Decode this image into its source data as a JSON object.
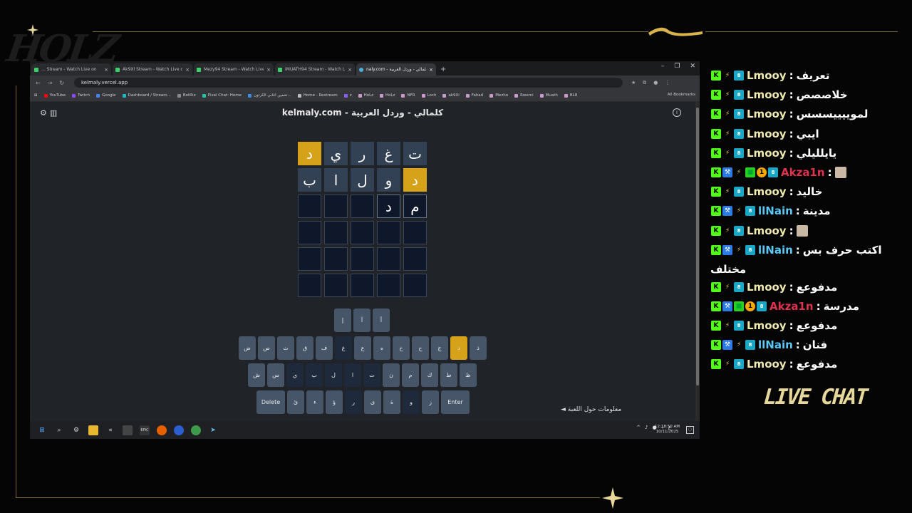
{
  "overlay": {
    "logo_text": "HOLZ",
    "live_chat_label": "LIVE CHAT"
  },
  "browser": {
    "tabs": [
      {
        "label": "... Stream - Watch Live on",
        "active": false
      },
      {
        "label": "Ak9Xl Stream - Watch Live on K",
        "active": false
      },
      {
        "label": "Mezy94 Stream - Watch Live o",
        "active": false
      },
      {
        "label": "iMUATH94 Stream - Watch Live",
        "active": false
      },
      {
        "label": "naly.com - كلمالي - وردل العربية",
        "active": true
      }
    ],
    "new_tab_label": "+",
    "url": "kelmaly.vercel.app",
    "bookmarks": [
      "YouTube",
      "Twitch",
      "Google",
      "Dashboard / Stream...",
      "BotRix",
      "Pixel Chat: Home",
      "تخمين اغاني الكرتون...",
      "Home - Restream",
      "z",
      "HoLz",
      "HoLz",
      "NFR",
      "Loch",
      "ak9Xl",
      "Fahad",
      "Mezho",
      "Rwemi",
      "Muath",
      "BL8"
    ],
    "all_bookmarks": "All Bookmarks"
  },
  "game": {
    "title": "kelmaly.com - كلمالي - وردل العربية",
    "rows": [
      [
        {
          "ch": "د",
          "s": "present"
        },
        {
          "ch": "ي",
          "s": "absent"
        },
        {
          "ch": "ر",
          "s": "absent"
        },
        {
          "ch": "غ",
          "s": "absent"
        },
        {
          "ch": "ت",
          "s": "absent"
        }
      ],
      [
        {
          "ch": "ب",
          "s": "absent"
        },
        {
          "ch": "ا",
          "s": "absent"
        },
        {
          "ch": "ل",
          "s": "absent"
        },
        {
          "ch": "و",
          "s": "absent"
        },
        {
          "ch": "د",
          "s": "present"
        }
      ],
      [
        {
          "ch": "",
          "s": "empty"
        },
        {
          "ch": "",
          "s": "empty"
        },
        {
          "ch": "",
          "s": "empty"
        },
        {
          "ch": "د",
          "s": "typed"
        },
        {
          "ch": "م",
          "s": "typed"
        }
      ],
      [
        {
          "ch": "",
          "s": "empty"
        },
        {
          "ch": "",
          "s": "empty"
        },
        {
          "ch": "",
          "s": "empty"
        },
        {
          "ch": "",
          "s": "empty"
        },
        {
          "ch": "",
          "s": "empty"
        }
      ],
      [
        {
          "ch": "",
          "s": "empty"
        },
        {
          "ch": "",
          "s": "empty"
        },
        {
          "ch": "",
          "s": "empty"
        },
        {
          "ch": "",
          "s": "empty"
        },
        {
          "ch": "",
          "s": "empty"
        }
      ],
      [
        {
          "ch": "",
          "s": "empty"
        },
        {
          "ch": "",
          "s": "empty"
        },
        {
          "ch": "",
          "s": "empty"
        },
        {
          "ch": "",
          "s": "empty"
        },
        {
          "ch": "",
          "s": "empty"
        }
      ]
    ],
    "keyboard": [
      [
        {
          "k": "إ"
        },
        {
          "k": "آ"
        },
        {
          "k": "أ"
        }
      ],
      [
        {
          "k": "ض"
        },
        {
          "k": "ص"
        },
        {
          "k": "ث"
        },
        {
          "k": "ق"
        },
        {
          "k": "ف"
        },
        {
          "k": "غ",
          "s": "absent"
        },
        {
          "k": "ع"
        },
        {
          "k": "ه"
        },
        {
          "k": "خ"
        },
        {
          "k": "ح"
        },
        {
          "k": "ج"
        },
        {
          "k": "د",
          "s": "present"
        },
        {
          "k": "ذ"
        }
      ],
      [
        {
          "k": "ش"
        },
        {
          "k": "س"
        },
        {
          "k": "ي",
          "s": "absent"
        },
        {
          "k": "ب",
          "s": "absent"
        },
        {
          "k": "ل",
          "s": "absent"
        },
        {
          "k": "ا",
          "s": "absent"
        },
        {
          "k": "ت",
          "s": "absent"
        },
        {
          "k": "ن"
        },
        {
          "k": "م"
        },
        {
          "k": "ك"
        },
        {
          "k": "ط"
        },
        {
          "k": "ظ"
        }
      ],
      [
        {
          "k": "Delete"
        },
        {
          "k": "ئ"
        },
        {
          "k": "ء"
        },
        {
          "k": "ؤ"
        },
        {
          "k": "ر",
          "s": "absent"
        },
        {
          "k": "ى"
        },
        {
          "k": "ة"
        },
        {
          "k": "و",
          "s": "absent"
        },
        {
          "k": "ز"
        },
        {
          "k": "Enter"
        }
      ]
    ],
    "footer_link": "◄ معلومات حول اللعبة"
  },
  "taskbar": {
    "clock_time": "12:18:50 AM",
    "clock_date": "10/11/2025",
    "lang": "ع"
  },
  "chat": {
    "messages": [
      {
        "user": "Lmooy",
        "text": "تعريف",
        "badges": [
          "k",
          "bolt",
          "sub"
        ],
        "color": "#f0e9b0"
      },
      {
        "user": "Lmooy",
        "text": "خلاصصص",
        "badges": [
          "k",
          "bolt",
          "sub"
        ],
        "color": "#f0e9b0"
      },
      {
        "user": "Lmooy",
        "text": "لموييييسسس",
        "badges": [
          "k",
          "bolt",
          "sub"
        ],
        "color": "#f0e9b0"
      },
      {
        "user": "Lmooy",
        "text": "ايبي",
        "badges": [
          "k",
          "bolt",
          "sub"
        ],
        "color": "#f0e9b0"
      },
      {
        "user": "Lmooy",
        "text": "يايلليلي",
        "badges": [
          "k",
          "bolt",
          "sub"
        ],
        "color": "#f0e9b0"
      },
      {
        "user": "Akza1n",
        "text": "",
        "badges": [
          "k",
          "sword",
          "bolt",
          "cube",
          "num",
          "sub"
        ],
        "color": "#e0314f",
        "emote": true
      },
      {
        "user": "Lmooy",
        "text": "خاليد",
        "badges": [
          "k",
          "bolt",
          "sub"
        ],
        "color": "#f0e9b0"
      },
      {
        "user": "llNain",
        "text": "مدينة",
        "badges": [
          "k",
          "sword",
          "bolt",
          "sub"
        ],
        "color": "#5bc8f5"
      },
      {
        "user": "Lmooy",
        "text": "",
        "badges": [
          "k",
          "bolt",
          "sub"
        ],
        "color": "#f0e9b0",
        "emote": true
      },
      {
        "user": "llNain",
        "text": "اكتب حرف بس",
        "badges": [
          "k",
          "sword",
          "bolt",
          "sub"
        ],
        "color": "#5bc8f5"
      },
      {
        "user": "Lmooy",
        "text": "مدفوعع",
        "badges": [
          "k",
          "bolt",
          "sub"
        ],
        "color": "#f0e9b0"
      },
      {
        "user": "Akza1n",
        "text": "مدرسة",
        "badges": [
          "k",
          "sword",
          "cube",
          "num",
          "sub"
        ],
        "color": "#e0314f"
      },
      {
        "user": "Lmooy",
        "text": "مدفوعع",
        "badges": [
          "k",
          "bolt",
          "sub"
        ],
        "color": "#f0e9b0"
      },
      {
        "user": "llNain",
        "text": "فنان",
        "badges": [
          "k",
          "sword",
          "bolt",
          "sub"
        ],
        "color": "#5bc8f5"
      },
      {
        "user": "Lmooy",
        "text": "مدفوعع",
        "badges": [
          "k",
          "bolt",
          "sub"
        ],
        "color": "#f0e9b0"
      }
    ],
    "wrap_continuation": "مختلف"
  }
}
